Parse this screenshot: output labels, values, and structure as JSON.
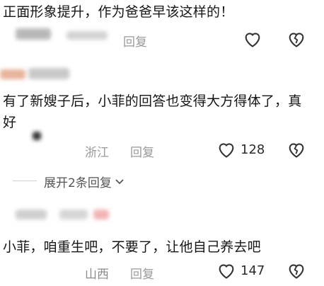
{
  "comments": [
    {
      "text": "正面形象提升，作为爸爸早该这样的！",
      "location": "",
      "reply": "回复",
      "likes": ""
    },
    {
      "text": "有了新嫂子后，小菲的回答也变得大方得体了，真好",
      "location": "浙江",
      "reply": "回复",
      "likes": "128"
    },
    {
      "text": "小菲，咱重生吧，不要了，让他自己养去吧",
      "location": "山西",
      "reply": "回复",
      "likes": "147"
    }
  ],
  "expand_replies": "展开2条回复"
}
